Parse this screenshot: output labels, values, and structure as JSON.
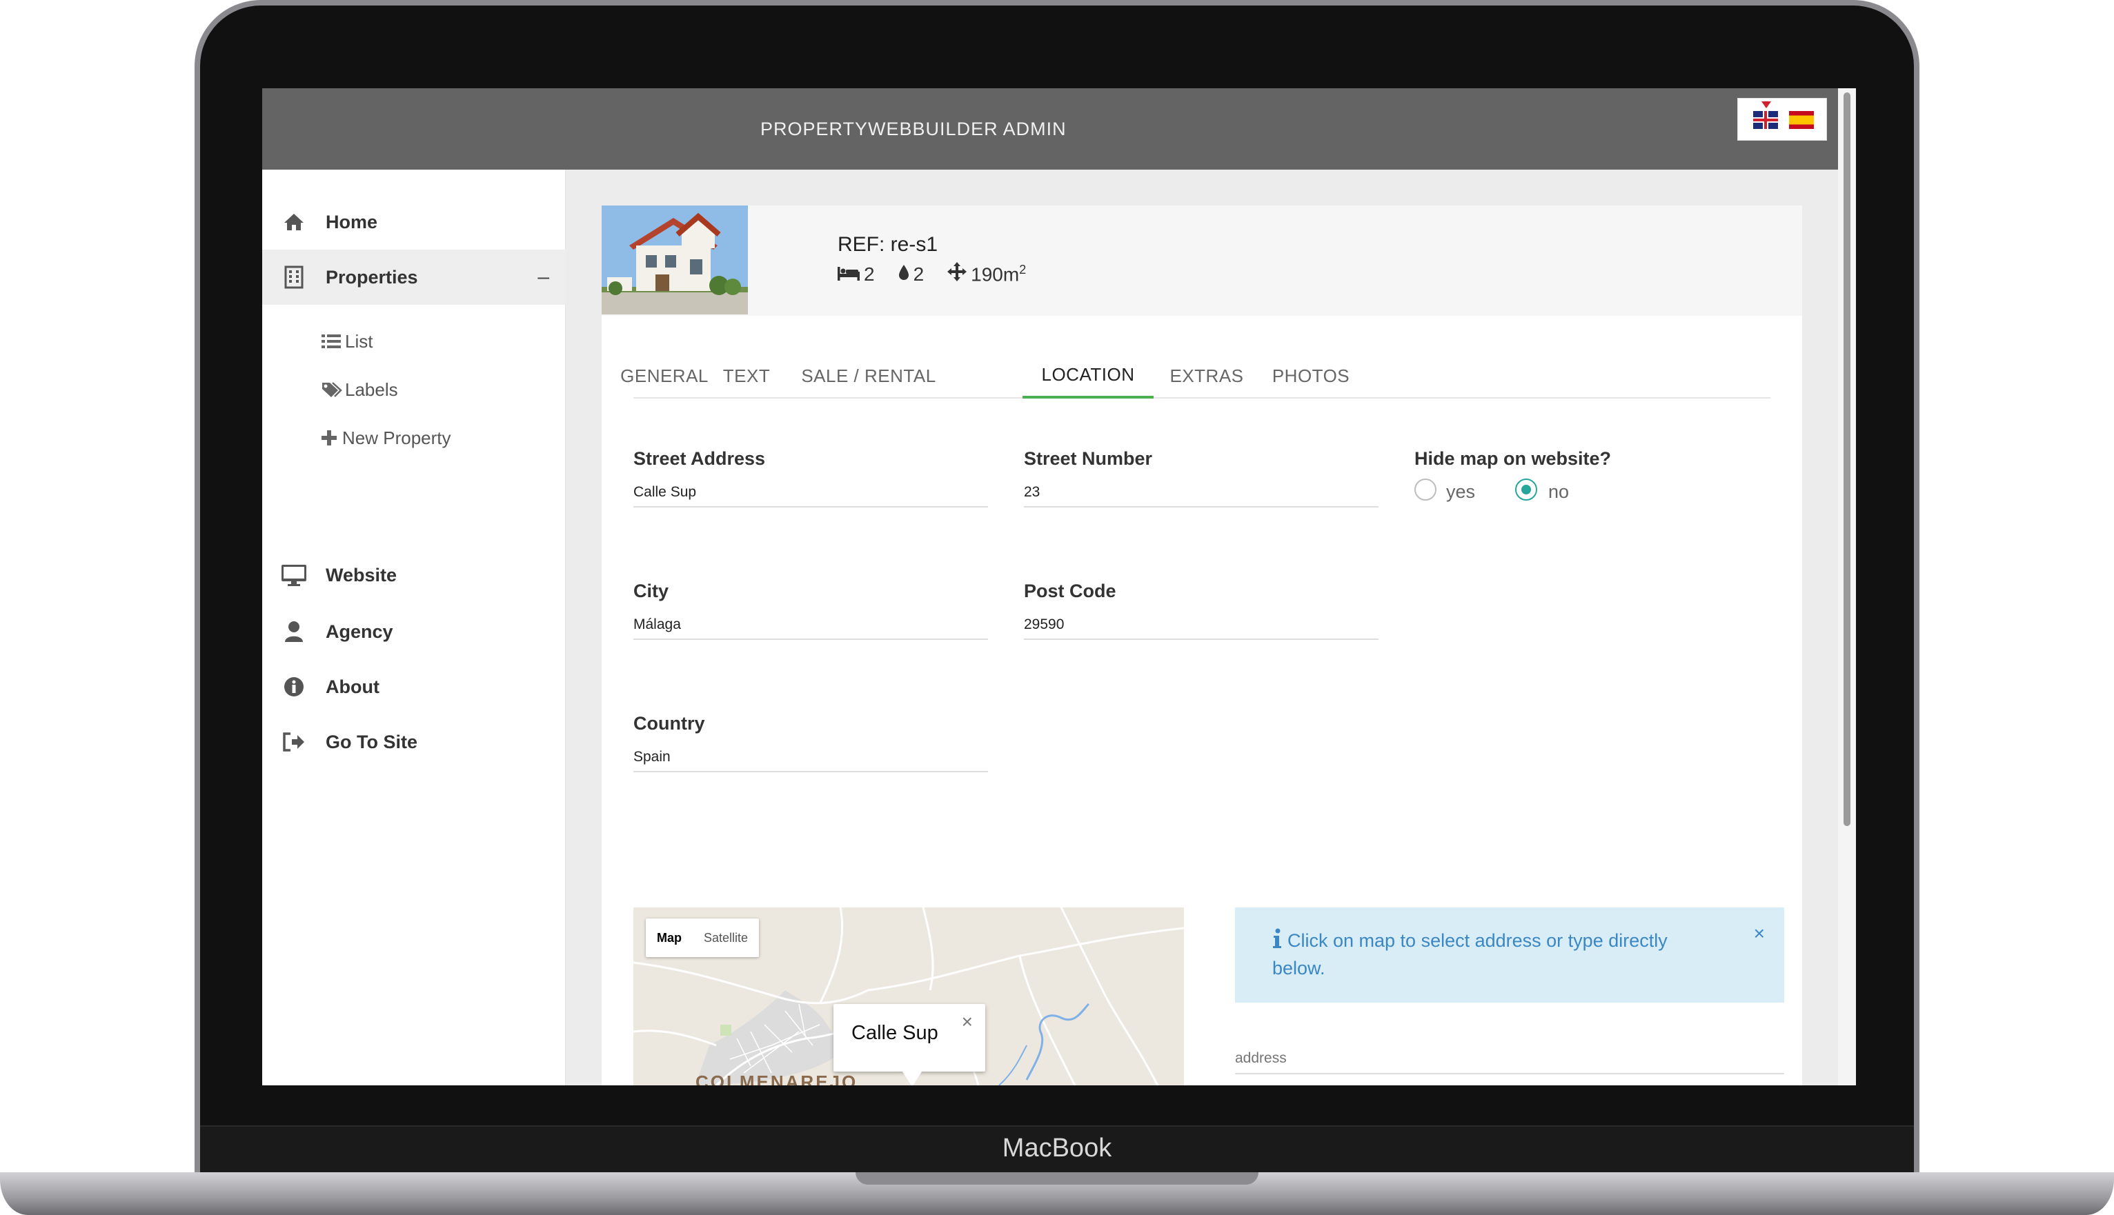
{
  "device": {
    "brand": "MacBook"
  },
  "header": {
    "title": "PROPERTYWEBBUILDER ADMIN",
    "languages": [
      "en",
      "es"
    ]
  },
  "sidebar": {
    "items": [
      {
        "label": "Home",
        "icon": "home-icon"
      },
      {
        "label": "Properties",
        "icon": "building-icon",
        "toggle": "–"
      },
      {
        "label": "Website",
        "icon": "monitor-icon"
      },
      {
        "label": "Agency",
        "icon": "user-icon"
      },
      {
        "label": "About",
        "icon": "info-icon"
      },
      {
        "label": "Go To Site",
        "icon": "sign-out-icon"
      }
    ],
    "sub_items": [
      {
        "label": "List",
        "icon": "list-icon"
      },
      {
        "label": "Labels",
        "icon": "tags-icon"
      },
      {
        "label": "New Property",
        "icon": "plus-icon"
      }
    ]
  },
  "property": {
    "ref": "REF: re-s1",
    "bedrooms": "2",
    "bathrooms": "2",
    "area": "190m",
    "area_unit_sup": "2"
  },
  "tabs": [
    {
      "label": "GENERAL"
    },
    {
      "label": "TEXT"
    },
    {
      "label": "SALE / RENTAL"
    },
    {
      "label": "LOCATION",
      "active": true
    },
    {
      "label": "EXTRAS"
    },
    {
      "label": "PHOTOS"
    }
  ],
  "form": {
    "street_address": {
      "label": "Street Address",
      "value": "Calle Sup"
    },
    "street_number": {
      "label": "Street Number",
      "value": "23"
    },
    "hide_map": {
      "label": "Hide map on website?",
      "yes": "yes",
      "no": "no",
      "selected": "no"
    },
    "city": {
      "label": "City",
      "value": "Málaga"
    },
    "post_code": {
      "label": "Post Code",
      "value": "29590"
    },
    "country": {
      "label": "Country",
      "value": "Spain"
    }
  },
  "map": {
    "type_options": [
      "Map",
      "Satellite"
    ],
    "selected_type": "Map",
    "town_label": "COLMENAREJO",
    "popup_title": "Calle Sup",
    "popup_close": "×"
  },
  "alert": {
    "text": "Click on map to select address or type directly below.",
    "close": "×"
  },
  "address": {
    "placeholder": "address"
  },
  "colors": {
    "accent_tab": "#4caf50",
    "radio": "#26a69a",
    "alert_bg": "#d9edf7",
    "alert_text": "#3a87c4",
    "topbar": "#646464"
  }
}
